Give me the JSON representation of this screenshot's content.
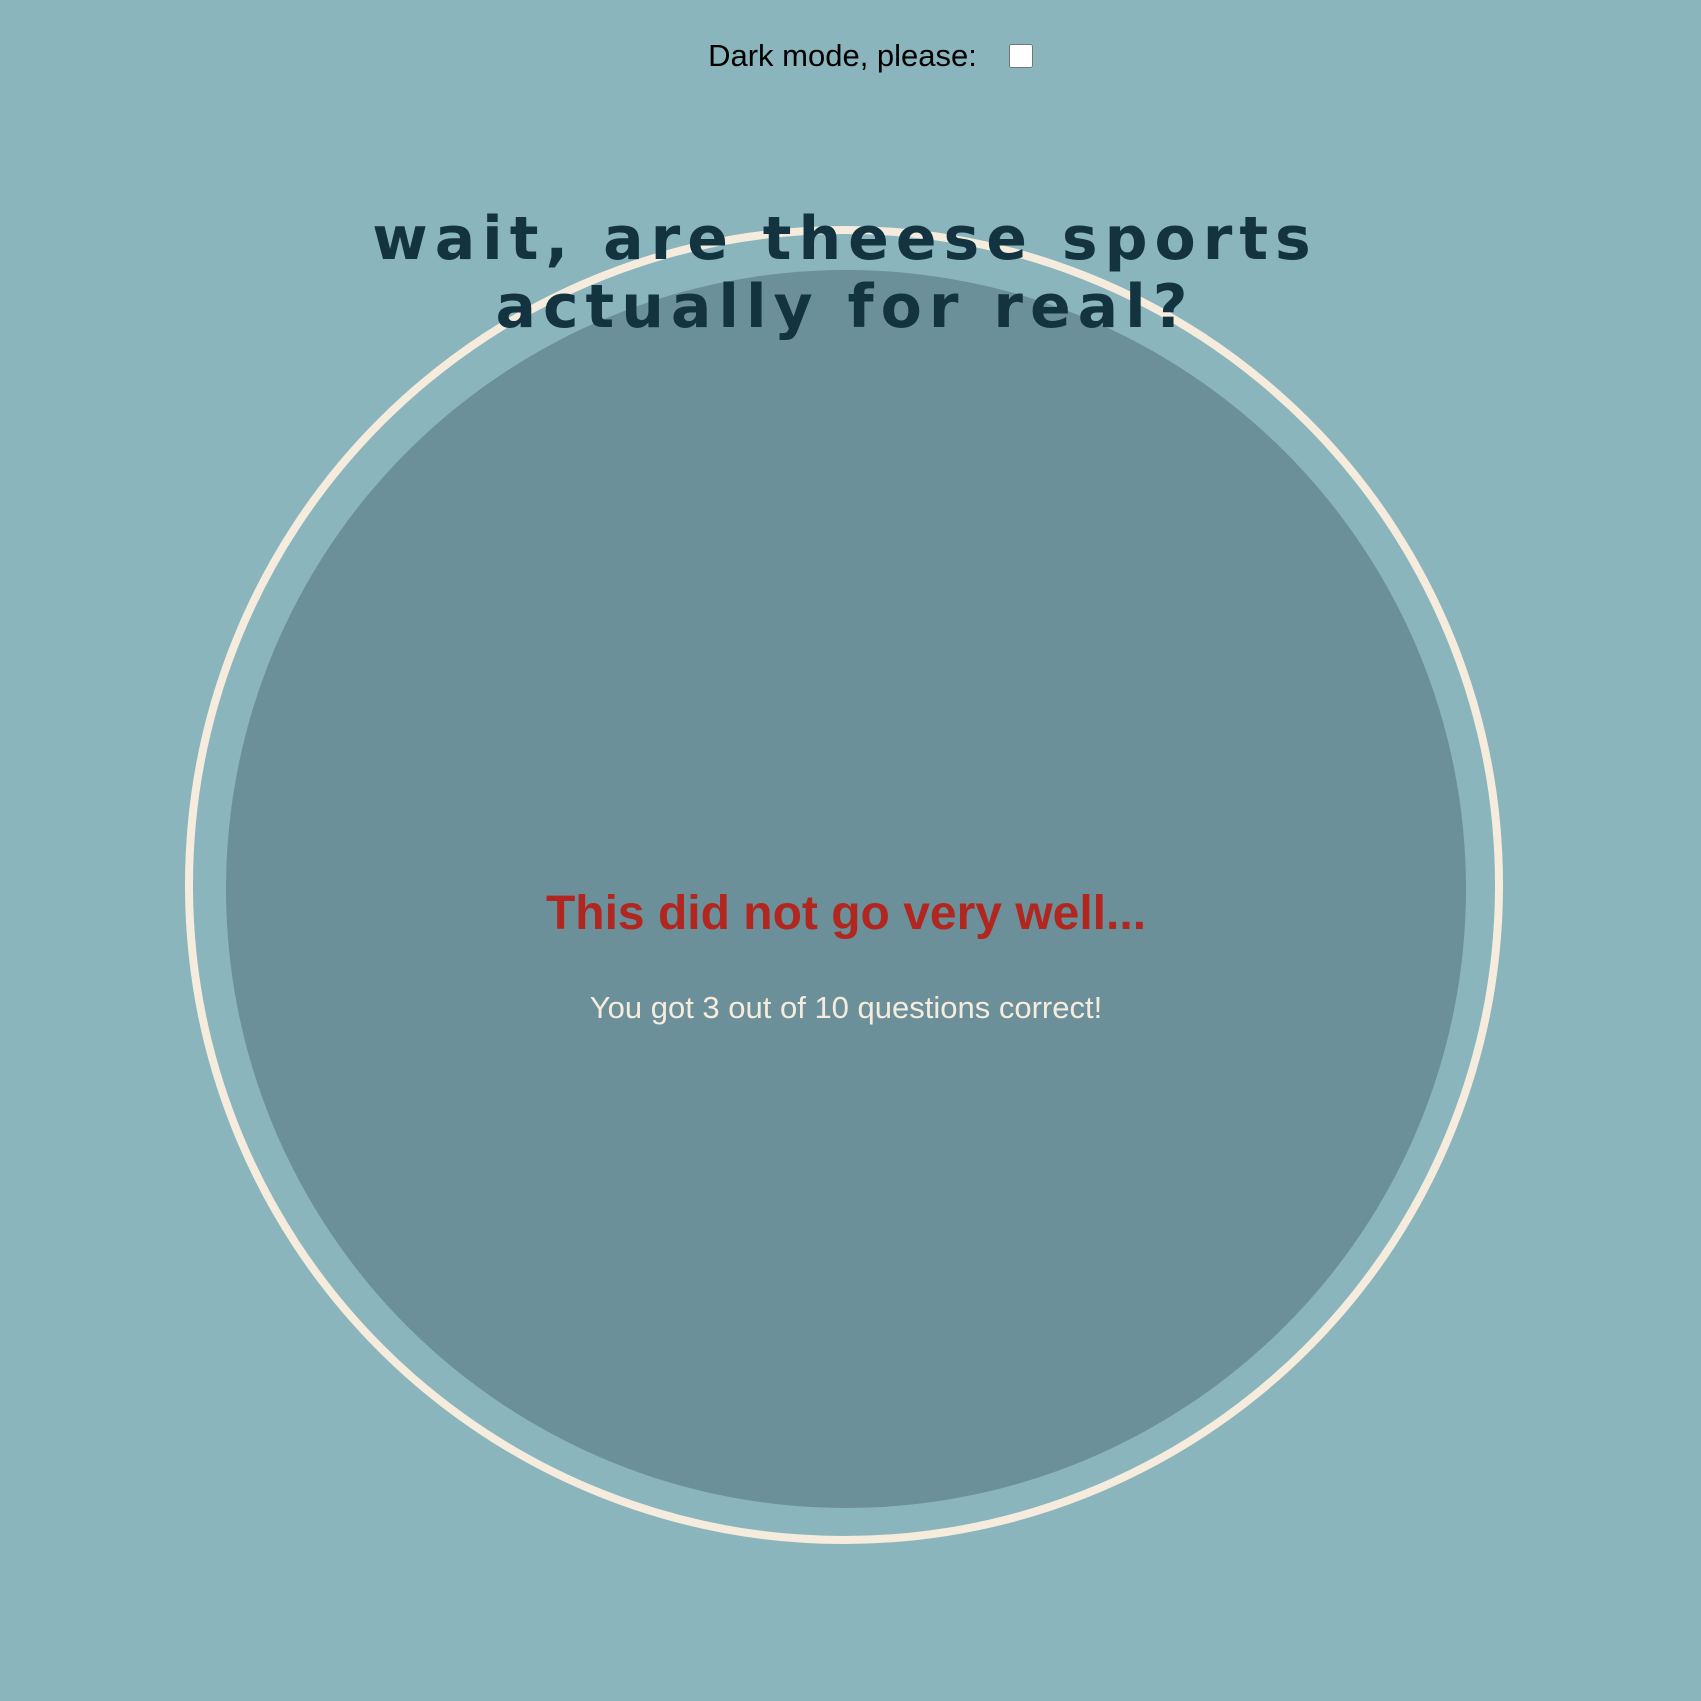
{
  "dark_mode": {
    "label": "Dark mode, please:",
    "checked": false
  },
  "quiz": {
    "title": "wait, are theese sports actually for real?",
    "result_heading": "This did not go very well...",
    "result_score": "You got 3 out of 10 questions correct!",
    "score": {
      "correct": 3,
      "total": 10
    }
  },
  "colors": {
    "page_background": "#8bb5bd",
    "disc": "#6c909a",
    "ring": "#f6ecdd",
    "title": "#12333f",
    "result_heading": "#b1271f",
    "result_score": "#f6ecdd"
  }
}
